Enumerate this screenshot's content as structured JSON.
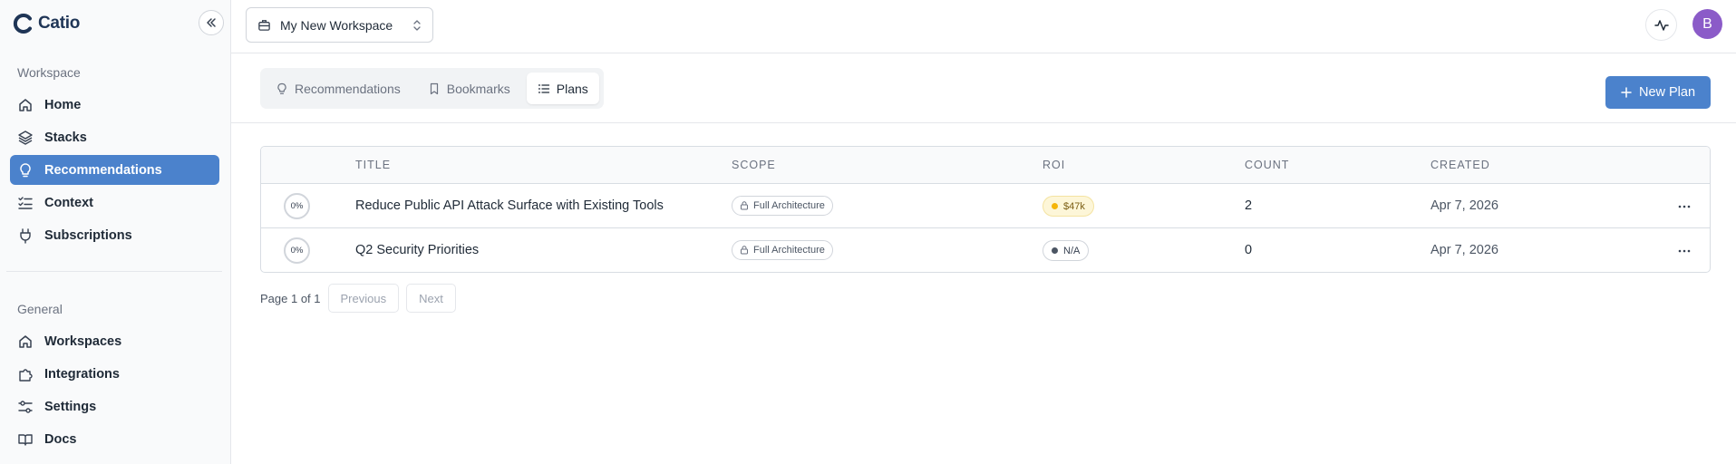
{
  "app": {
    "name": "Catio"
  },
  "sidebar": {
    "sections": [
      {
        "label": "Workspace"
      },
      {
        "label": "General"
      }
    ],
    "workspace_items": [
      {
        "label": "Home",
        "icon": "home-icon"
      },
      {
        "label": "Stacks",
        "icon": "layers-icon"
      },
      {
        "label": "Recommendations",
        "icon": "lightbulb-icon",
        "active": true
      },
      {
        "label": "Context",
        "icon": "list-checks-icon"
      },
      {
        "label": "Subscriptions",
        "icon": "plug-icon"
      }
    ],
    "general_items": [
      {
        "label": "Workspaces",
        "icon": "home-icon"
      },
      {
        "label": "Integrations",
        "icon": "puzzle-icon"
      },
      {
        "label": "Settings",
        "icon": "sliders-icon"
      },
      {
        "label": "Docs",
        "icon": "book-icon"
      }
    ]
  },
  "topbar": {
    "workspace": "My New Workspace",
    "avatar_initial": "B"
  },
  "tabs": [
    {
      "label": "Recommendations",
      "icon": "lightbulb-icon"
    },
    {
      "label": "Bookmarks",
      "icon": "bookmark-icon"
    },
    {
      "label": "Plans",
      "icon": "list-icon",
      "active": true
    }
  ],
  "actions": {
    "new_plan": "New Plan"
  },
  "table": {
    "headers": [
      "TITLE",
      "SCOPE",
      "ROI",
      "COUNT",
      "CREATED"
    ],
    "rows": [
      {
        "progress": "0%",
        "title": "Reduce Public API Attack Surface with Existing Tools",
        "scope": "Full Architecture",
        "roi": "$47k",
        "roi_color": "#f5b50a",
        "count": "2",
        "created": "Apr 7, 2026"
      },
      {
        "progress": "0%",
        "title": "Q2 Security Priorities",
        "scope": "Full Architecture",
        "roi": "N/A",
        "roi_color": "#4b5563",
        "count": "0",
        "created": "Apr 7, 2026"
      }
    ]
  },
  "pagination": {
    "label": "Page 1 of 1",
    "previous": "Previous",
    "next": "Next"
  },
  "colors": {
    "accent": "#4b82cc",
    "avatar": "#8b5bc8"
  }
}
